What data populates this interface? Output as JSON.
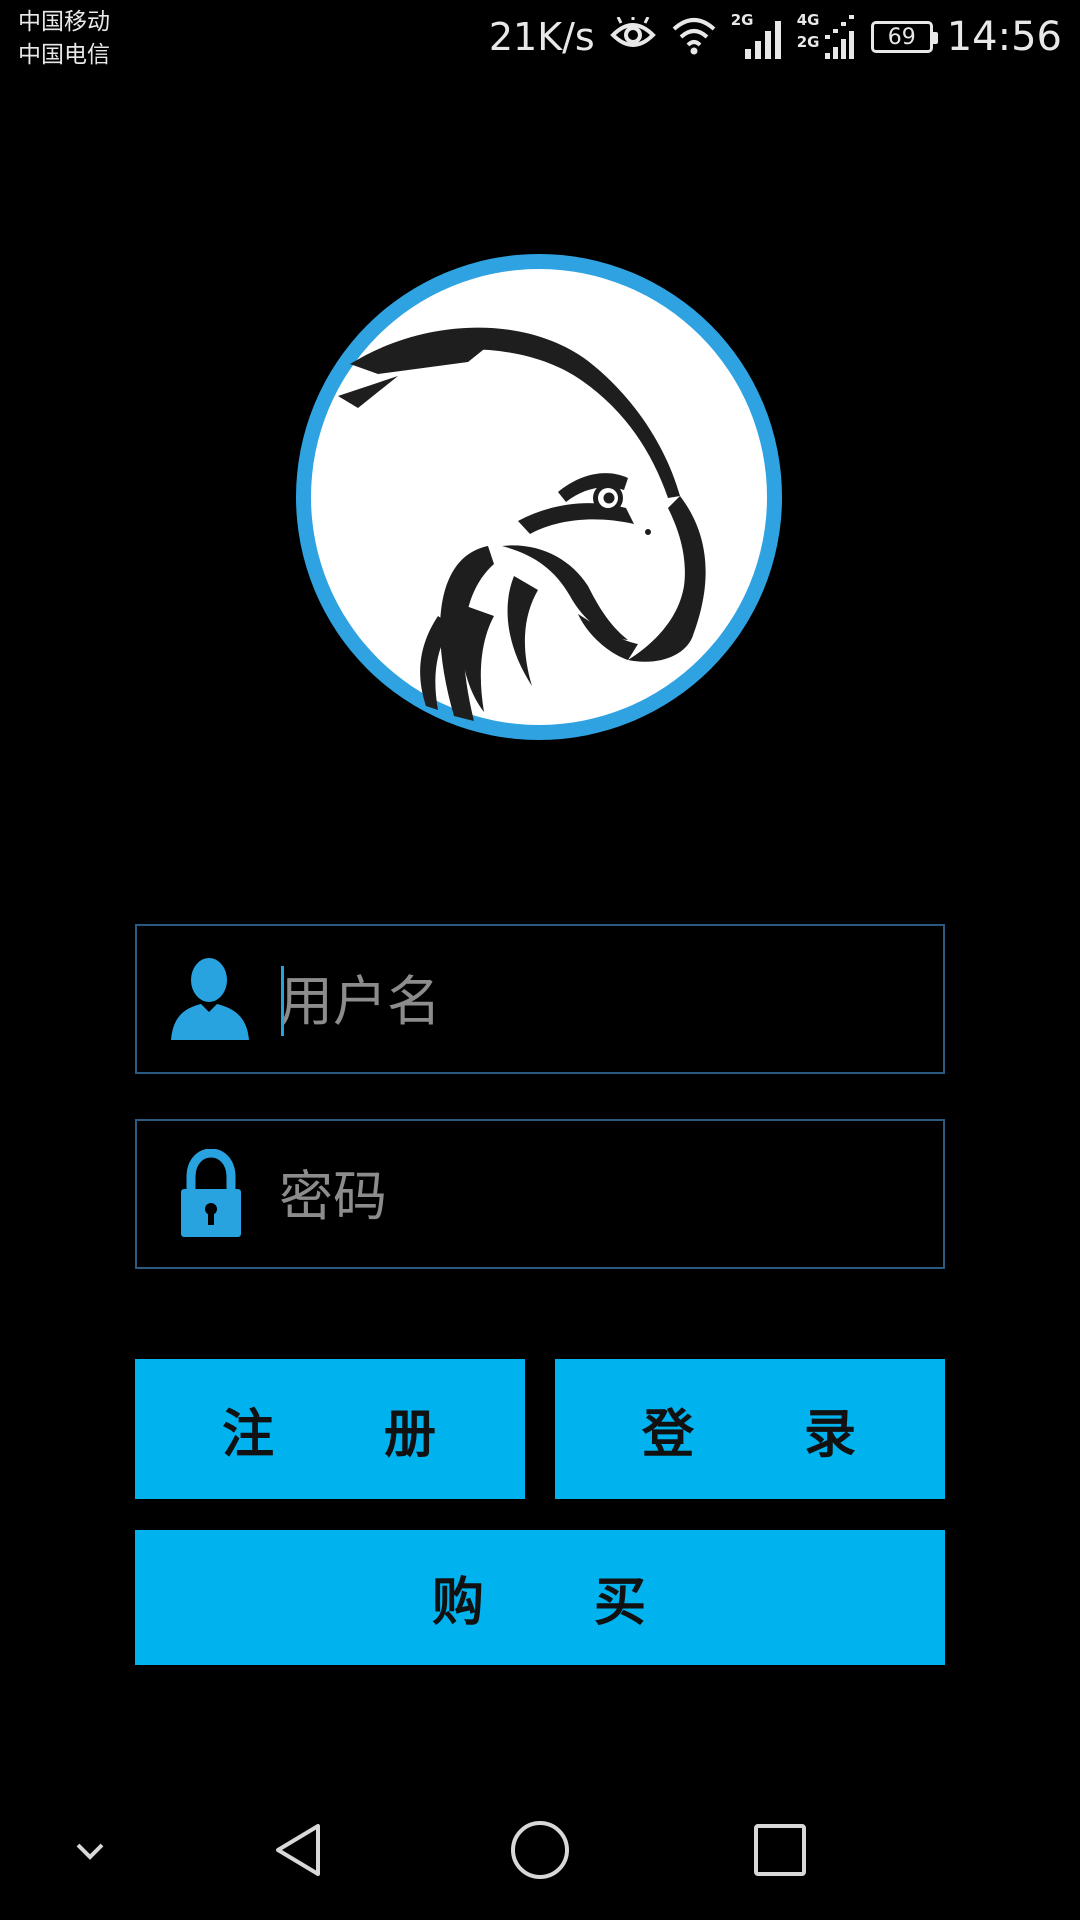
{
  "status_bar": {
    "carrier_1": "中国移动",
    "carrier_2": "中国电信",
    "net_speed": "21K/s",
    "signal_1_tag": "2G",
    "signal_2_tag_top": "4G",
    "signal_2_tag_bottom": "2G",
    "battery_level": "69",
    "time": "14:56",
    "icons": [
      "eye-icon",
      "wifi-icon",
      "signal-icon",
      "dual-signal-icon",
      "battery-icon"
    ]
  },
  "logo": {
    "icon": "eagle-logo",
    "ring_color": "#2fa3e1"
  },
  "login_form": {
    "username": {
      "icon": "user-icon",
      "value": "",
      "placeholder": "用户名"
    },
    "password": {
      "icon": "lock-icon",
      "value": "",
      "placeholder": "密码"
    }
  },
  "buttons": {
    "register_label": "注　　册",
    "login_label": "登　　录",
    "buy_label": "购　　买"
  },
  "nav_bar": {
    "icons": [
      "chevron-down-icon",
      "back-icon",
      "home-icon",
      "recents-icon"
    ]
  },
  "colors": {
    "background": "#000000",
    "accent": "#00b2ee",
    "icon_blue": "#29a3e0",
    "field_border": "#2a5a82",
    "placeholder": "#8c8c8c"
  }
}
